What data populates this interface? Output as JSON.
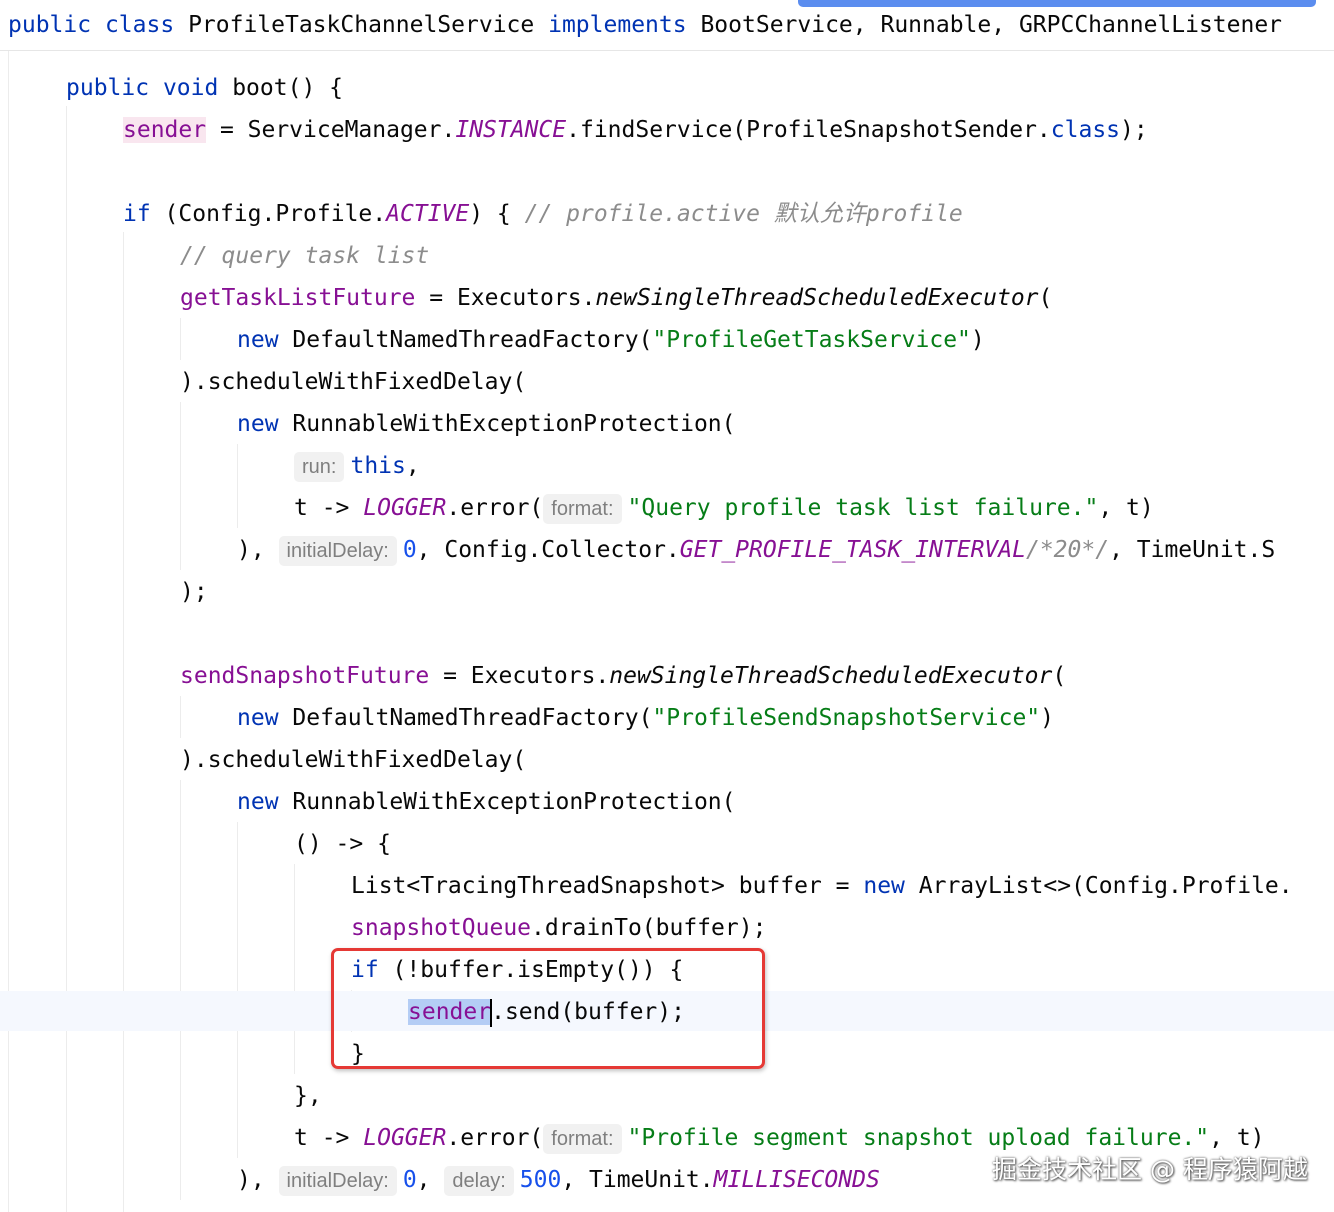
{
  "header": {
    "kw_public": "public",
    "kw_class": "class",
    "class_name": "ProfileTaskChannelService",
    "kw_implements": "implements",
    "interfaces": "BootService, Runnable, GRPCChannelListener"
  },
  "lines": {
    "boot_public": "public",
    "boot_void": "void",
    "boot_name": "boot",
    "boot_rest": "() {",
    "sender_field": "sender",
    "sender_eq": " = ServiceManager.",
    "instance": "INSTANCE",
    "find_service": ".findService(ProfileSnapshotSender.",
    "class_kw": "class",
    "find_end": ");",
    "if_kw": "if",
    "if_cond": " (Config.Profile.",
    "active": "ACTIVE",
    "if_end": ") { ",
    "if_comment": "// profile.active 默认允许profile",
    "query_comment": "// query task list",
    "get_future": "getTaskListFuture",
    "get_eq": " = Executors.",
    "new_exec": "newSingleThreadScheduledExecutor",
    "paren_open": "(",
    "new_kw": "new",
    "factory": " DefaultNamedThreadFactory(",
    "factory_name_1": "\"ProfileGetTaskService\"",
    "close_paren": ")",
    "schedule": ").scheduleWithFixedDelay(",
    "runnable": " RunnableWithExceptionProtection(",
    "hint_run": "run:",
    "this_kw": "this",
    "comma": ",",
    "t_arrow": "t -> ",
    "logger": "LOGGER",
    "error_call": ".error(",
    "hint_format": "format:",
    "error_msg_1": "\"Query profile task list failure.\"",
    "error_end": ", t)",
    "close_args": "), ",
    "hint_initial_delay": "initialDelay:",
    "zero": "0",
    "config_collector": ", Config.Collector.",
    "interval": "GET_PROFILE_TASK_INTERVAL",
    "interval_comment": "/*20*/",
    "timeunit_tail": ", TimeUnit.S",
    "close_stmt": ");",
    "send_future": "sendSnapshotFuture",
    "factory_name_2": "\"ProfileSendSnapshotService\"",
    "lambda": "() -> {",
    "list_decl": "List<TracingThreadSnapshot> buffer = ",
    "arraylist": " ArrayList<>(Config.Profile.",
    "snapshot_queue": "snapshotQueue",
    "drain": ".drainTo(buffer);",
    "if2_kw": "if",
    "if2_cond": " (!buffer.isEmpty()) {",
    "sender_sel": "sender",
    "send_call": ".send(buffer);",
    "close_brace": "}",
    "close_lambda": "},",
    "error_msg_2": "\"Profile segment snapshot upload failure.\"",
    "hint_delay": "delay:",
    "five_hundred": "500",
    "timeunit": ", TimeUnit.",
    "millis": "MILLISECONDS"
  },
  "watermark": "掘金技术社区 @ 程序猿阿越",
  "colors": {
    "keyword": "#0033b3",
    "field": "#871094",
    "string": "#067d17",
    "number": "#1750eb",
    "comment": "#8c8c8c",
    "highlight_box": "#e53935",
    "selection": "#b4cdf5"
  }
}
